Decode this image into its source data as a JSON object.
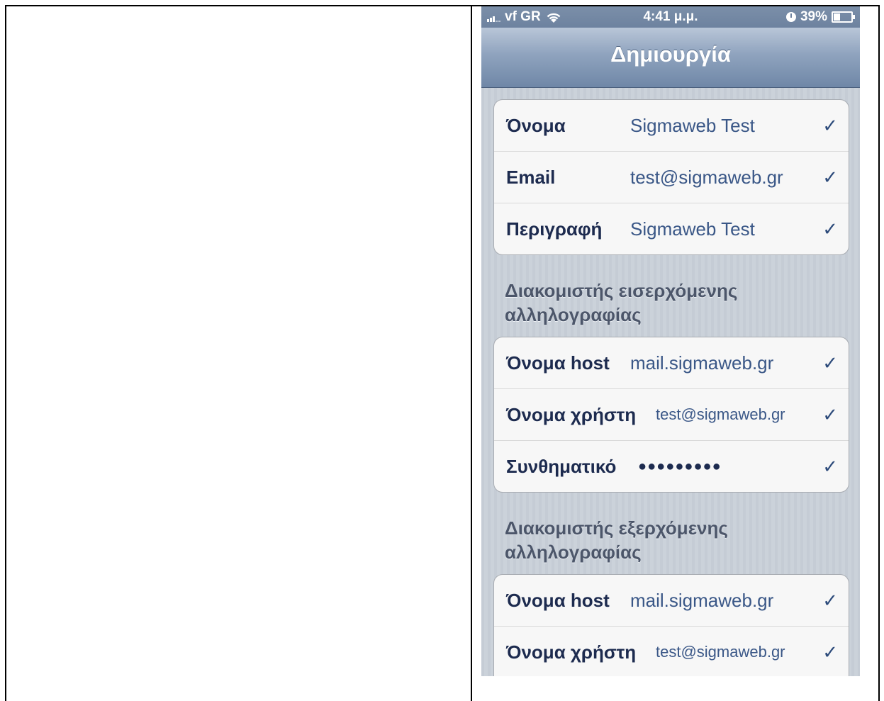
{
  "status_bar": {
    "carrier": "vf GR",
    "time": "4:41 μ.μ.",
    "battery": "39%",
    "battery_level": 0.39
  },
  "nav": {
    "title": "Δημιουργία"
  },
  "account": {
    "rows": [
      {
        "label": "Όνομα",
        "value": "Sigmaweb Test",
        "check": "✓"
      },
      {
        "label": "Email",
        "value": "test@sigmaweb.gr",
        "check": "✓"
      },
      {
        "label": "Περιγραφή",
        "value": "Sigmaweb Test",
        "check": "✓"
      }
    ]
  },
  "incoming": {
    "header": "Διακομιστής εισερχόμενης αλληλογραφίας",
    "rows": [
      {
        "label": "Όνομα host",
        "value": "mail.sigmaweb.gr",
        "check": "✓"
      },
      {
        "label": "Όνομα χρήστη",
        "value": "test@sigmaweb.gr",
        "check": "✓"
      },
      {
        "label": "Συνθηματικό",
        "value": "●●●●●●●●●",
        "check": "✓"
      }
    ]
  },
  "outgoing": {
    "header": "Διακομιστής εξερχόμενης αλληλογραφίας",
    "rows": [
      {
        "label": "Όνομα host",
        "value": "mail.sigmaweb.gr",
        "check": "✓"
      },
      {
        "label": "Όνομα χρήστη",
        "value": "test@sigmaweb.gr",
        "check": "✓"
      }
    ]
  }
}
